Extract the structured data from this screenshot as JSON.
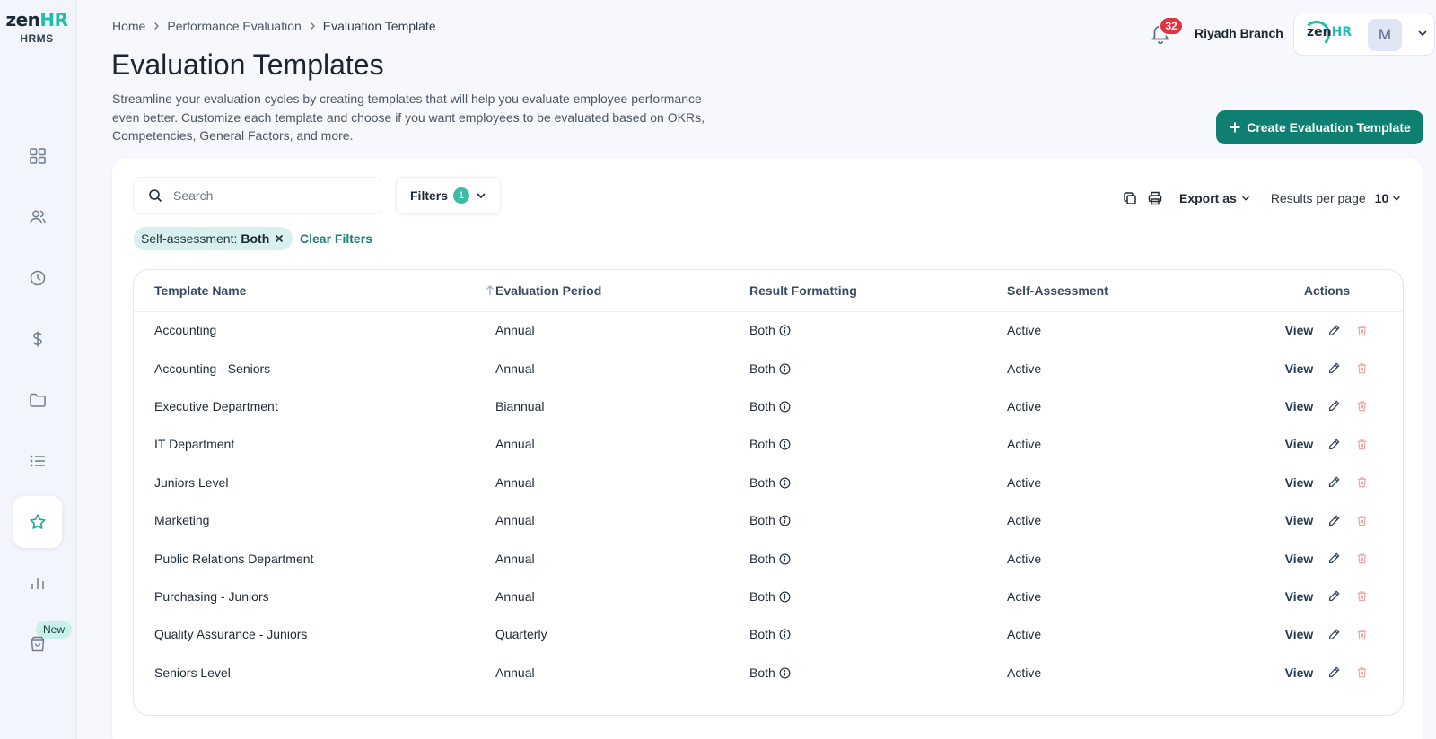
{
  "sidebar": {
    "brand_left": "zen",
    "brand_right": "HR",
    "brand_sub": "HRMS",
    "items": [
      {
        "icon": "dashboard-icon"
      },
      {
        "icon": "users-icon"
      },
      {
        "icon": "clock-icon"
      },
      {
        "icon": "dollar-icon"
      },
      {
        "icon": "folder-icon"
      },
      {
        "icon": "list-icon"
      },
      {
        "icon": "star-icon",
        "active": true
      },
      {
        "icon": "bar-chart-icon"
      },
      {
        "icon": "shopping-bag-icon"
      }
    ],
    "new_badge": "New"
  },
  "breadcrumb": [
    "Home",
    "Performance Evaluation",
    "Evaluation Template"
  ],
  "page": {
    "title": "Evaluation Templates",
    "description": "Streamline your evaluation cycles by creating templates that will help you evaluate employee performance even better. Customize each template and choose if you want employees to be evaluated based on OKRs, Competencies, General Factors, and more."
  },
  "header": {
    "notification_count": "32",
    "branch": "Riyadh Branch",
    "avatar_initial": "M",
    "profile_logo_left": "zen",
    "profile_logo_right": "HR"
  },
  "actions": {
    "create_label": "Create Evaluation Template"
  },
  "toolbar": {
    "search_placeholder": "Search",
    "filters_label": "Filters",
    "filters_count": "1",
    "export_label": "Export as",
    "results_label": "Results per page",
    "results_value": "10"
  },
  "active_filter": {
    "label": "Self-assessment:",
    "value": "Both",
    "clear_label": "Clear Filters"
  },
  "table": {
    "columns": [
      "Template Name",
      "Evaluation Period",
      "Result Formatting",
      "Self-Assessment",
      "Actions"
    ],
    "view_label": "View",
    "rows": [
      {
        "name": "Accounting",
        "period": "Annual",
        "format": "Both",
        "self": "Active"
      },
      {
        "name": "Accounting - Seniors",
        "period": "Annual",
        "format": "Both",
        "self": "Active"
      },
      {
        "name": "Executive Department",
        "period": "Biannual",
        "format": "Both",
        "self": "Active"
      },
      {
        "name": "IT Department",
        "period": "Annual",
        "format": "Both",
        "self": "Active"
      },
      {
        "name": "Juniors Level",
        "period": "Annual",
        "format": "Both",
        "self": "Active"
      },
      {
        "name": "Marketing",
        "period": "Annual",
        "format": "Both",
        "self": "Active"
      },
      {
        "name": "Public Relations Department",
        "period": "Annual",
        "format": "Both",
        "self": "Active"
      },
      {
        "name": "Purchasing - Juniors",
        "period": "Annual",
        "format": "Both",
        "self": "Active"
      },
      {
        "name": "Quality Assurance - Juniors",
        "period": "Quarterly",
        "format": "Both",
        "self": "Active"
      },
      {
        "name": "Seniors Level",
        "period": "Annual",
        "format": "Both",
        "self": "Active"
      }
    ]
  },
  "colors": {
    "accent": "#0f7f72",
    "chip_bg": "#d7f2ee",
    "badge_red": "#e0333f",
    "delete_pink": "#f2a6a6"
  }
}
